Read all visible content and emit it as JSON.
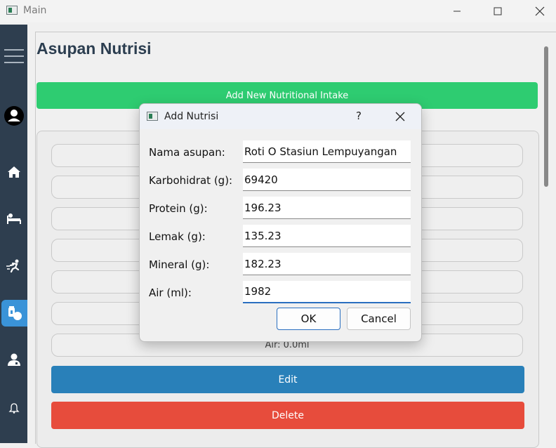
{
  "window": {
    "title": "Main"
  },
  "page": {
    "title": "Asupan Nutrisi",
    "add_button_label": "Add New Nutritional Intake",
    "detail_rows": [
      "",
      "",
      "",
      "",
      "",
      "",
      "Air: 0.0ml"
    ],
    "edit_label": "Edit",
    "delete_label": "Delete"
  },
  "sidebar": {
    "items": [
      {
        "icon": "hamburger-menu-icon"
      },
      {
        "icon": "user-avatar-icon"
      },
      {
        "icon": "home-icon"
      },
      {
        "icon": "sleep-icon"
      },
      {
        "icon": "running-icon"
      },
      {
        "icon": "nutrition-icon",
        "active": true
      },
      {
        "icon": "doctor-icon"
      },
      {
        "icon": "bell-icon"
      }
    ],
    "active_color": "#3a93d8"
  },
  "dialog": {
    "title": "Add Nutrisi",
    "help": "?",
    "fields": [
      {
        "label": "Nama asupan:",
        "value": "Roti O Stasiun Lempuyangan"
      },
      {
        "label": "Karbohidrat (g):",
        "value": "69420"
      },
      {
        "label": "Protein (g):",
        "value": "196.23"
      },
      {
        "label": "Lemak (g):",
        "value": "135.23"
      },
      {
        "label": "Mineral (g):",
        "value": "182.23"
      },
      {
        "label": "Air (ml):",
        "value": "1982"
      }
    ],
    "ok_label": "OK",
    "cancel_label": "Cancel"
  },
  "colors": {
    "add": "#2ecc71",
    "edit": "#2980b9",
    "delete": "#e74c3c",
    "sidebar": "#2e3e4f"
  }
}
